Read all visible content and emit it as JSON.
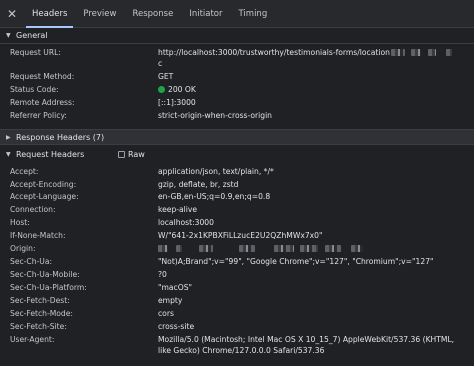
{
  "tabs": {
    "close": "✕",
    "items": [
      "Headers",
      "Preview",
      "Response",
      "Initiator",
      "Timing"
    ],
    "active": "Headers"
  },
  "general": {
    "title": "General",
    "rows": [
      {
        "key": "Request URL:",
        "value": "http://localhost:3000/trustworthy/testimonials-forms/location",
        "value2": "c"
      },
      {
        "key": "Request Method:",
        "value": "GET"
      },
      {
        "key": "Status Code:",
        "value": "200 OK",
        "status_color": "#1ea446"
      },
      {
        "key": "Remote Address:",
        "value": "[::1]:3000"
      },
      {
        "key": "Referrer Policy:",
        "value": "strict-origin-when-cross-origin"
      }
    ]
  },
  "response_headers": {
    "title": "Response Headers (7)"
  },
  "request_headers": {
    "title": "Request Headers",
    "raw_label": "Raw",
    "rows": [
      {
        "key": "Accept:",
        "value": "application/json, text/plain, */*"
      },
      {
        "key": "Accept-Encoding:",
        "value": "gzip, deflate, br, zstd"
      },
      {
        "key": "Accept-Language:",
        "value": "en-GB,en-US;q=0.9,en;q=0.8"
      },
      {
        "key": "Connection:",
        "value": "keep-alive"
      },
      {
        "key": "Host:",
        "value": "localhost:3000"
      },
      {
        "key": "If-None-Match:",
        "value": "W/\"641-2x1KPBXFiLLzucE2U2QZhMWx7x0\""
      },
      {
        "key": "Origin:",
        "value": ""
      },
      {
        "key": "Sec-Ch-Ua:",
        "value": "\"Not)A;Brand\";v=\"99\", \"Google Chrome\";v=\"127\", \"Chromium\";v=\"127\""
      },
      {
        "key": "Sec-Ch-Ua-Mobile:",
        "value": "?0"
      },
      {
        "key": "Sec-Ch-Ua-Platform:",
        "value": "\"macOS\""
      },
      {
        "key": "Sec-Fetch-Dest:",
        "value": "empty"
      },
      {
        "key": "Sec-Fetch-Mode:",
        "value": "cors"
      },
      {
        "key": "Sec-Fetch-Site:",
        "value": "cross-site"
      },
      {
        "key": "User-Agent:",
        "value": "Mozilla/5.0 (Macintosh; Intel Mac OS X 10_15_7) AppleWebKit/537.36 (KHTML, like Gecko) Chrome/127.0.0.0 Safari/537.36"
      }
    ]
  }
}
